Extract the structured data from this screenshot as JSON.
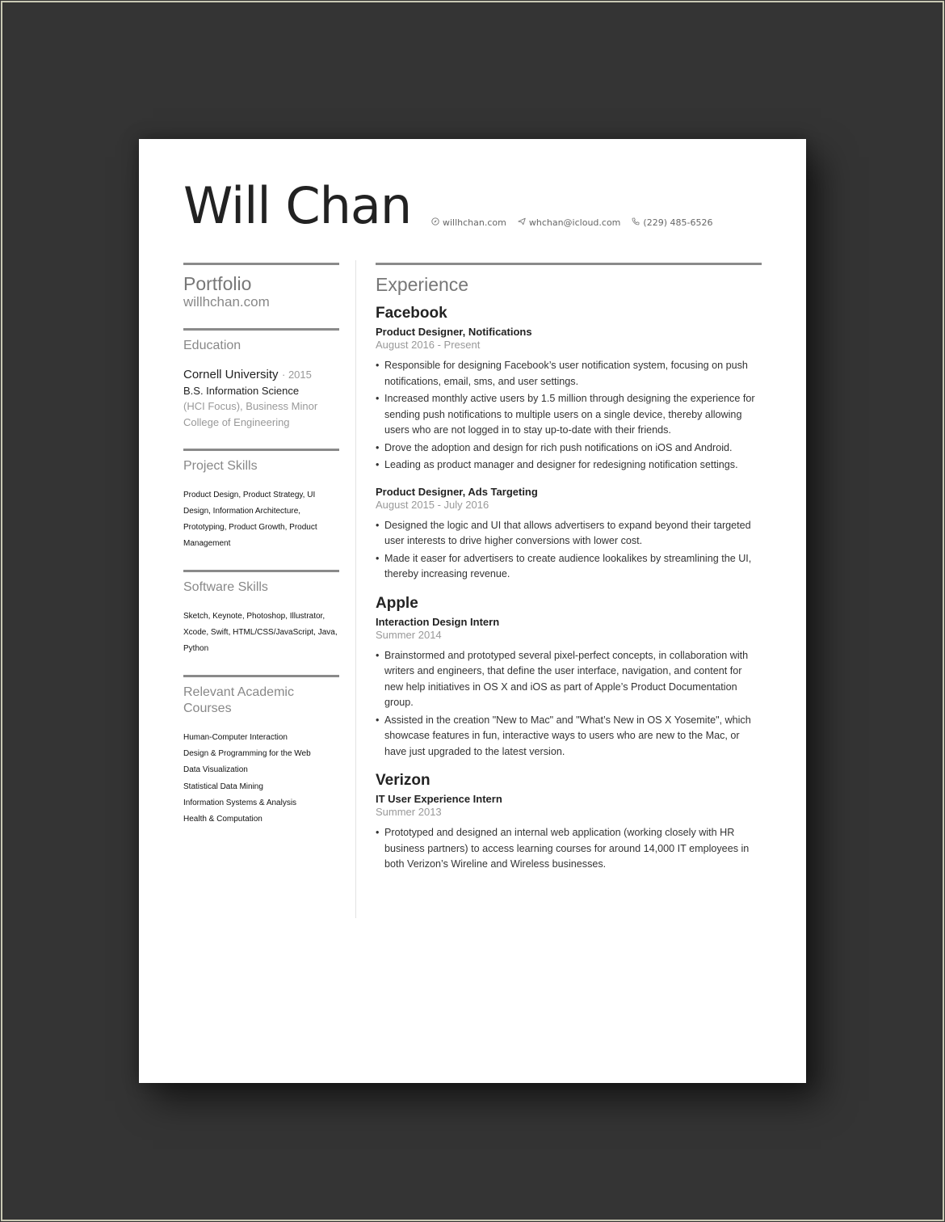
{
  "header": {
    "name": "Will Chan",
    "contacts": [
      {
        "icon": "compass-icon",
        "text": "willhchan.com"
      },
      {
        "icon": "send-icon",
        "text": "whchan@icloud.com"
      },
      {
        "icon": "phone-icon",
        "text": "(229) 485-6526"
      }
    ]
  },
  "sidebar": {
    "portfolio": {
      "title": "Portfolio",
      "url": "willhchan.com"
    },
    "education": {
      "heading": "Education",
      "school": "Cornell University",
      "year": "· 2015",
      "degree": "B.S. Information Science",
      "focus": "(HCI Focus), Business Minor",
      "college": "College of Engineering"
    },
    "project_skills": {
      "heading": "Project Skills",
      "text": "Product Design, Product Strategy, UI Design, Information Architecture, Prototyping, Product Growth, Product Management"
    },
    "software_skills": {
      "heading": "Software Skills",
      "text": "Sketch, Keynote, Photoshop, Illustrator, Xcode, Swift, HTML/CSS/JavaScript, Java, Python"
    },
    "courses": {
      "heading": "Relevant Academic Courses",
      "items": [
        "Human-Computer Interaction",
        "Design & Programming for the Web",
        "Data Visualization",
        "Statistical Data Mining",
        "Information Systems & Analysis",
        "Health & Computation"
      ]
    }
  },
  "experience": {
    "heading": "Experience",
    "companies": [
      {
        "name": "Facebook",
        "roles": [
          {
            "title": "Product Designer, Notifications",
            "dates": "August 2016 - Present",
            "bullets": [
              "Responsible for designing Facebook’s user notification system, focusing on push notifications, email, sms, and user settings.",
              "Increased monthly active users by 1.5 million through designing the experience for sending push notifications to multiple users on a single device, thereby allowing users who are not logged in to stay up-to-date with their friends.",
              "Drove the adoption and design for rich push notifications on iOS and Android.",
              "Leading as product manager and designer for redesigning notification settings."
            ]
          },
          {
            "title": "Product Designer, Ads Targeting",
            "dates": "August 2015 - July 2016",
            "bullets": [
              "Designed the logic and UI that allows advertisers to expand beyond their targeted user interests to drive higher conversions with lower cost.",
              "Made it easer for advertisers to create audience lookalikes by streamlining the UI, thereby increasing revenue."
            ]
          }
        ]
      },
      {
        "name": "Apple",
        "roles": [
          {
            "title": "Interaction Design Intern",
            "dates": "Summer 2014",
            "bullets": [
              "Brainstormed and prototyped several pixel-perfect concepts, in collaboration with writers and engineers, that define the user interface, navigation, and content for new help initiatives in OS X and iOS as part of Apple’s Product Documentation group.",
              "Assisted in the creation \"New to Mac\" and \"What’s New in OS X Yosemite\", which showcase features in fun, interactive ways to users who are new to the Mac, or have just upgraded to the latest version."
            ]
          }
        ]
      },
      {
        "name": "Verizon",
        "roles": [
          {
            "title": "IT User Experience Intern",
            "dates": "Summer 2013",
            "bullets": [
              "Prototyped and designed an internal web application (working closely with HR business partners) to access learning courses for around 14,000 IT employees in both Verizon’s Wireline and Wireless businesses."
            ]
          }
        ]
      }
    ]
  }
}
